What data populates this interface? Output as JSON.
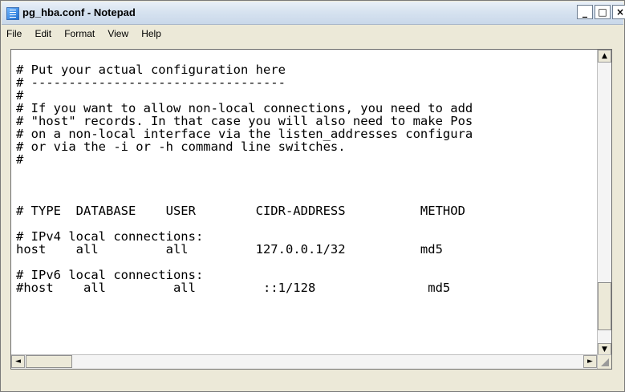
{
  "window": {
    "title": "pg_hba.conf - Notepad",
    "buttons": {
      "minimize": "_",
      "maximize": "□",
      "close": "×"
    }
  },
  "menu": [
    "File",
    "Edit",
    "Format",
    "View",
    "Help"
  ],
  "editor": {
    "content": "# Put your actual configuration here\n# ----------------------------------\n#\n# If you want to allow non-local connections, you need to add\n# \"host\" records. In that case you will also need to make Pos\n# on a non-local interface via the listen_addresses configura\n# or via the -i or -h command line switches.\n#\n\n\n\n# TYPE  DATABASE    USER        CIDR-ADDRESS          METHOD\n\n# IPv4 local connections:\nhost    all         all         127.0.0.1/32          md5\n\n# IPv6 local connections:\n#host    all         all         ::1/128               md5"
  },
  "scrollbar": {
    "up": "▲",
    "down": "▼",
    "left": "◄",
    "right": "►"
  }
}
